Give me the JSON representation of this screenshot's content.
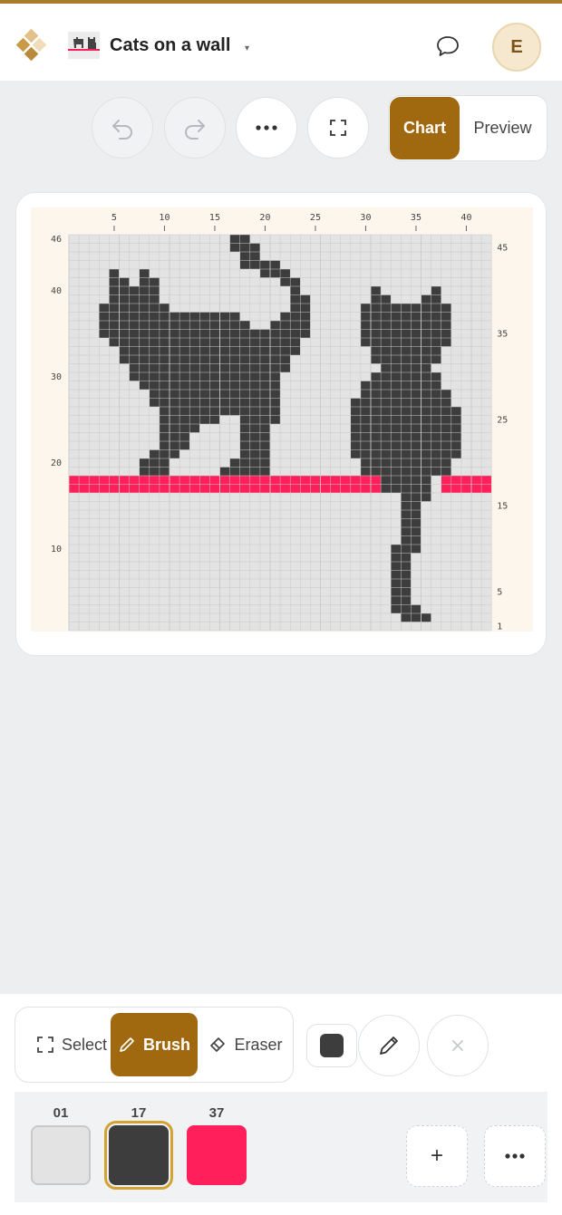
{
  "header": {
    "title": "Cats on a wall",
    "avatar_initial": "E",
    "icons": {
      "logo": "diamond-logo-icon",
      "thumbnail": "pattern-thumbnail",
      "caret": "caret-down-icon",
      "comment": "comment-icon"
    }
  },
  "view_toggle": {
    "chart_label": "Chart",
    "preview_label": "Preview",
    "active": "Chart"
  },
  "actions": {
    "undo_icon": "undo-icon",
    "redo_icon": "redo-icon",
    "more_icon": "more-icon",
    "fullscreen_icon": "fullscreen-icon"
  },
  "chart": {
    "columns": 42,
    "rows": 46,
    "top_labels": [
      "5",
      "10",
      "15",
      "20",
      "25",
      "30",
      "35",
      "40"
    ],
    "left_labels": [
      "46",
      "40",
      "30",
      "20",
      "10"
    ],
    "right_labels": [
      "45",
      "35",
      "25",
      "15",
      "5",
      "1"
    ],
    "colors": {
      "background": "#e3e3e3",
      "grid": "#c9c9c9",
      "frame": "#fdf6ec",
      "cat": "#3d3d3d",
      "wall": "#ff1f5a"
    }
  },
  "tools": {
    "select_label": "Select",
    "brush_label": "Brush",
    "eraser_label": "Eraser",
    "active": "Brush",
    "current_color": "#3d3d3d"
  },
  "palette": {
    "swatches": [
      {
        "number": "01",
        "color": "#e3e3e3"
      },
      {
        "number": "17",
        "color": "#3d3d3d"
      },
      {
        "number": "37",
        "color": "#ff1f5a"
      }
    ],
    "selected": "17",
    "add_icon": "plus-icon",
    "more_icon": "more-icon"
  }
}
